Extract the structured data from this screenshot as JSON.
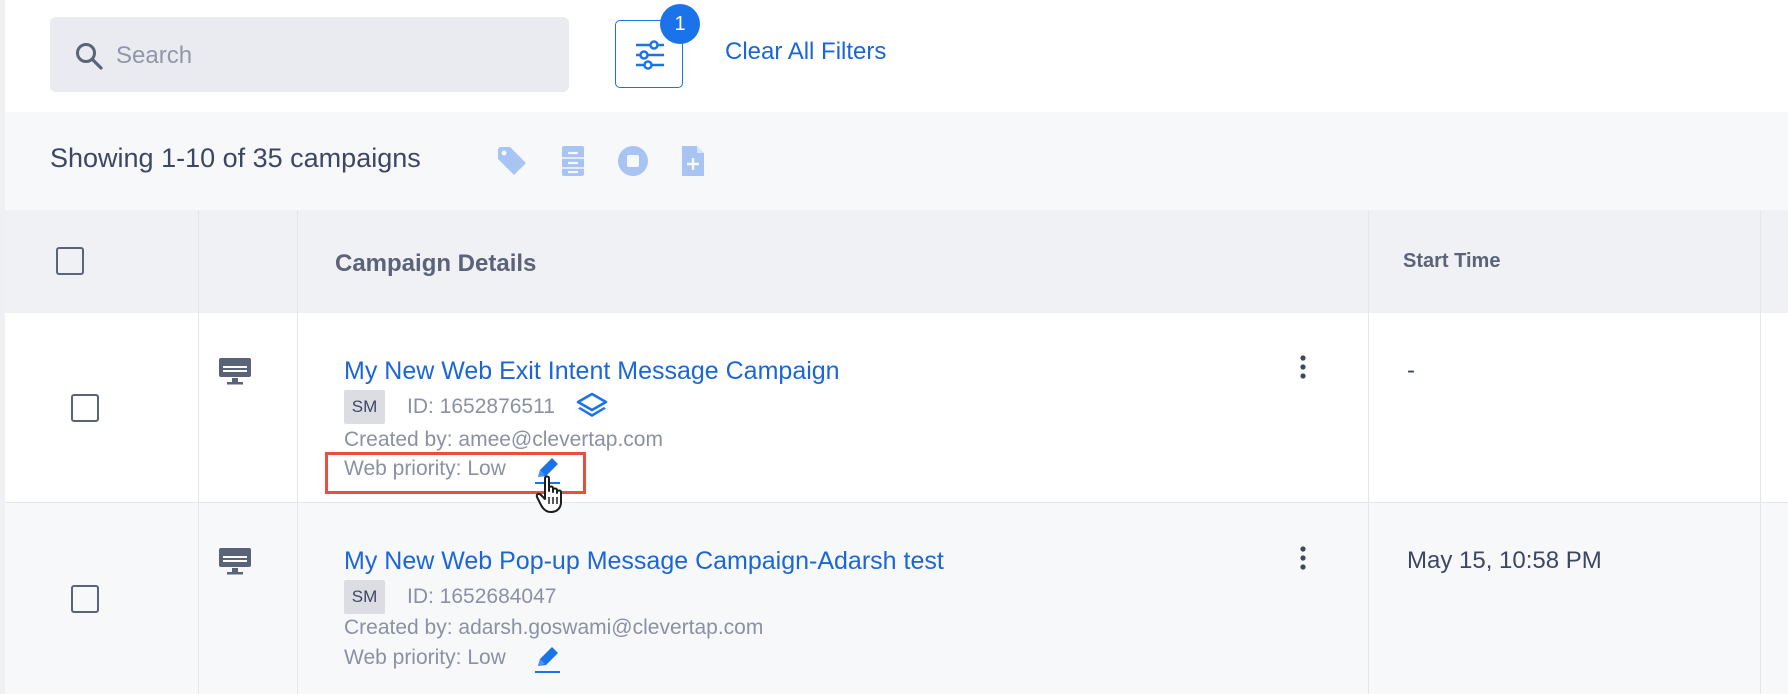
{
  "filters": {
    "search_placeholder": "Search",
    "filter_count": "1",
    "clear_label": "Clear All Filters"
  },
  "summary": {
    "count_text": "Showing 1-10 of 35 campaigns",
    "bulk_actions": [
      "tag-icon",
      "archive-icon",
      "stop-icon",
      "add-file-icon"
    ]
  },
  "table": {
    "headers": {
      "details": "Campaign Details",
      "start_time": "Start Time"
    },
    "rows": [
      {
        "device": "desktop-icon",
        "title": "My New Web Exit Intent Message Campaign",
        "tag": "SM",
        "id": "ID: 1652876511",
        "has_layers_icon": true,
        "created_by": "Created by: amee@clevertap.com",
        "priority": "Web priority: Low",
        "start_time": "-"
      },
      {
        "device": "desktop-icon",
        "title": "My New Web Pop-up Message Campaign-Adarsh test",
        "tag": "SM",
        "id": "ID: 1652684047",
        "has_layers_icon": false,
        "created_by": "Created by: adarsh.goswami@clevertap.com",
        "priority": "Web priority: Low",
        "start_time": "May 15, 10:58 PM"
      }
    ]
  },
  "colors": {
    "accent": "#1a73e8",
    "link": "#1a66d9",
    "highlight": "#e8503d",
    "muted_text": "#8a91a3"
  }
}
